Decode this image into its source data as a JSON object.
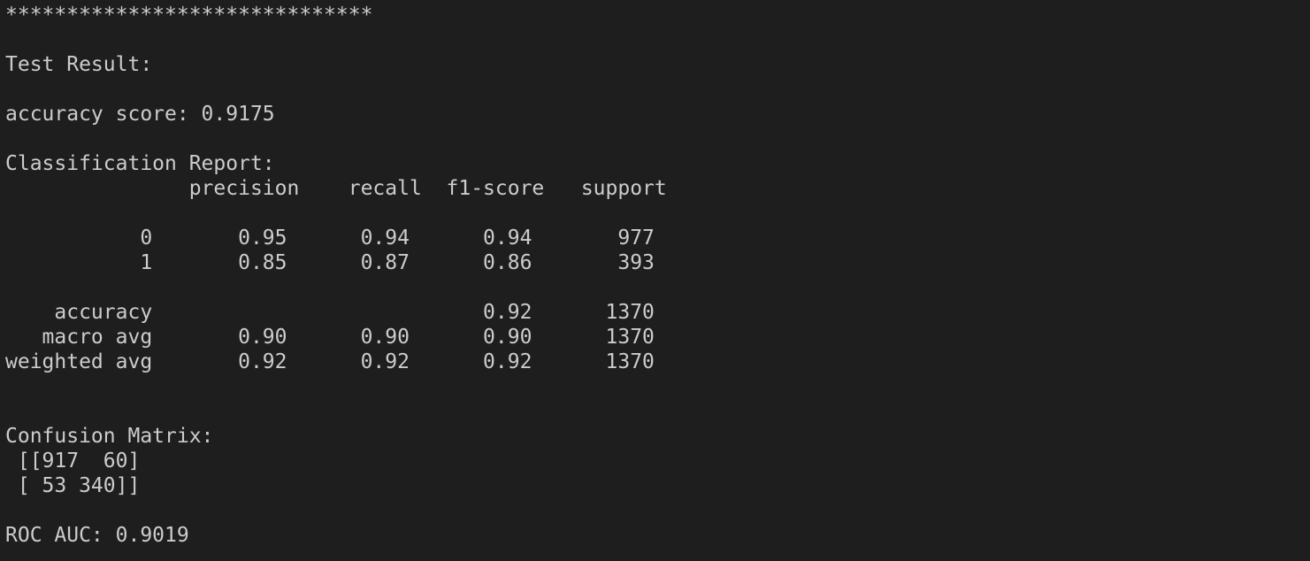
{
  "terminal": {
    "colors": {
      "background": "#1e1e1e",
      "foreground": "#cccccc"
    },
    "lines": [
      "******************************",
      "",
      "Test Result:",
      "",
      "accuracy score: 0.9175",
      "",
      "Classification Report:",
      "               precision    recall  f1-score   support",
      "",
      "           0       0.95      0.94      0.94       977",
      "           1       0.85      0.87      0.86       393",
      "",
      "    accuracy                           0.92      1370",
      "   macro avg       0.90      0.90      0.90      1370",
      "weighted avg       0.92      0.92      0.92      1370",
      "",
      "",
      "Confusion Matrix:",
      " [[917  60]",
      " [ 53 340]]",
      "",
      "ROC AUC: 0.9019"
    ]
  }
}
